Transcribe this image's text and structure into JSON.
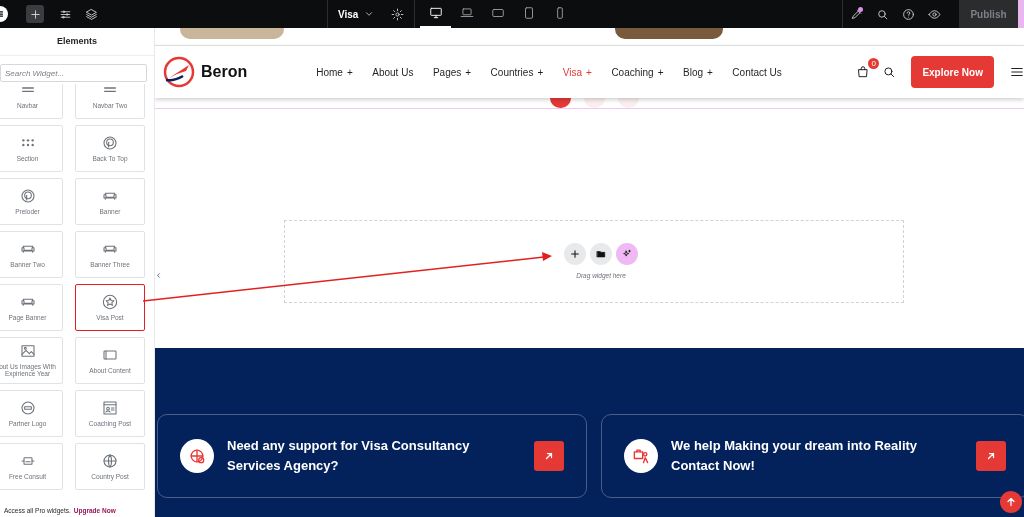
{
  "topbar": {
    "page_menu": "Visa",
    "devices": [
      {
        "kind": "desktop",
        "selected": true
      },
      {
        "kind": "laptop",
        "selected": false
      },
      {
        "kind": "tablet-landscape",
        "selected": false
      },
      {
        "kind": "tablet",
        "selected": false
      },
      {
        "kind": "mobile",
        "selected": false
      }
    ],
    "publish": "Publish"
  },
  "panel": {
    "title": "Elements",
    "search": {
      "placeholder": "Search Widget..."
    },
    "widgets": [
      {
        "label": "Navbar",
        "kind": "lines",
        "highlighted": false
      },
      {
        "label": "Navbar Two",
        "kind": "lines",
        "highlighted": false
      },
      {
        "label": "Section",
        "kind": "dots",
        "highlighted": false
      },
      {
        "label": "Back To Top",
        "kind": "ring",
        "highlighted": false
      },
      {
        "label": "Preloder",
        "kind": "ring",
        "highlighted": false
      },
      {
        "label": "Banner",
        "kind": "sofa",
        "highlighted": false
      },
      {
        "label": "Banner Two",
        "kind": "sofa",
        "highlighted": false
      },
      {
        "label": "Banner Three",
        "kind": "sofa",
        "highlighted": false
      },
      {
        "label": "Page Banner",
        "kind": "sofa",
        "highlighted": false
      },
      {
        "label": "Visa Post",
        "kind": "star",
        "highlighted": true
      },
      {
        "label": "out Us Images With Expirience Year",
        "kind": "image",
        "highlighted": false
      },
      {
        "label": "About Content",
        "kind": "frame",
        "highlighted": false
      },
      {
        "label": "Partner Logo",
        "kind": "badge",
        "highlighted": false
      },
      {
        "label": "Coaching Post",
        "kind": "card",
        "highlighted": false
      },
      {
        "label": "Free Consult",
        "kind": "ticket",
        "highlighted": false
      },
      {
        "label": "Country Post",
        "kind": "globe",
        "highlighted": false
      }
    ],
    "promo": {
      "text": "Access all Pro widgets.",
      "link": "Upgrade Now"
    }
  },
  "site_header": {
    "brand": "Beron",
    "nav": [
      {
        "label": "Home",
        "toggle": "+",
        "selected": false
      },
      {
        "label": "About Us",
        "selected": false
      },
      {
        "label": "Pages",
        "toggle": "+",
        "selected": false
      },
      {
        "label": "Countries",
        "toggle": "+",
        "selected": false
      },
      {
        "label": "Visa",
        "toggle": "+",
        "selected": true
      },
      {
        "label": "Coaching",
        "toggle": "+",
        "selected": false
      },
      {
        "label": "Blog",
        "toggle": "+",
        "selected": false
      },
      {
        "label": "Contact Us",
        "selected": false
      }
    ],
    "cart_count": "0",
    "cta": "Explore Now"
  },
  "slider_dots": [
    {
      "selected": true
    },
    {
      "selected": false
    },
    {
      "selected": false
    }
  ],
  "drop_zone": {
    "hint": "Drag widget here"
  },
  "cta_cards": [
    {
      "lines": [
        "Need any support for Visa Consultancy",
        "Services Agency?"
      ]
    },
    {
      "lines": [
        "We help Making your dream into Reality",
        "Contact Now!"
      ]
    }
  ]
}
